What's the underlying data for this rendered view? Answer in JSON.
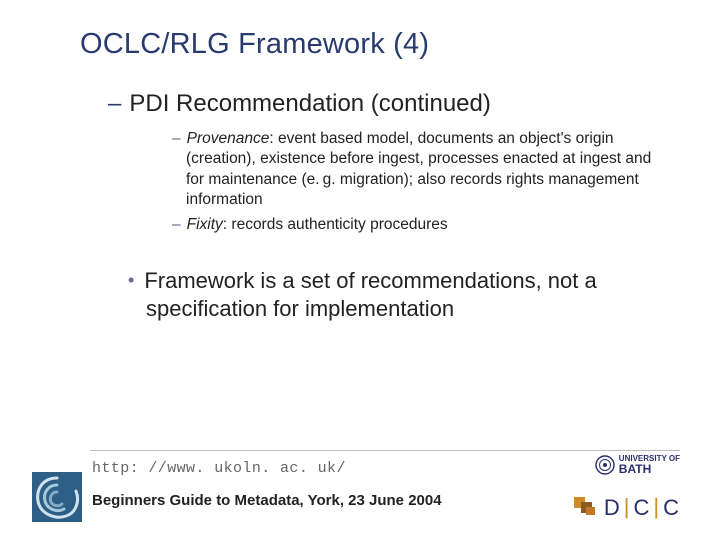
{
  "title": "OCLC/RLG Framework (4)",
  "lvl1": {
    "text": "PDI Recommendation (continued)"
  },
  "sub": [
    {
      "term": "Provenance",
      "body": ": event based model, documents an object's origin (creation), existence before ingest, processes enacted at ingest and for maintenance (e. g. migration); also records rights management information"
    },
    {
      "term": "Fixity",
      "body": ": records authenticity procedures"
    }
  ],
  "point": "Framework is a set of recommendations, not a specification for implementation",
  "url": "http: //www. ukoln. ac. uk/",
  "footline": "Beginners Guide to Metadata, York, 23 June 2004",
  "logos": {
    "ukoln": "UKOLN",
    "bath_top": "UNIVERSITY OF",
    "bath_bottom": "BATH",
    "dcc_d": "D",
    "dcc_c1": "C",
    "dcc_c2": "C"
  }
}
